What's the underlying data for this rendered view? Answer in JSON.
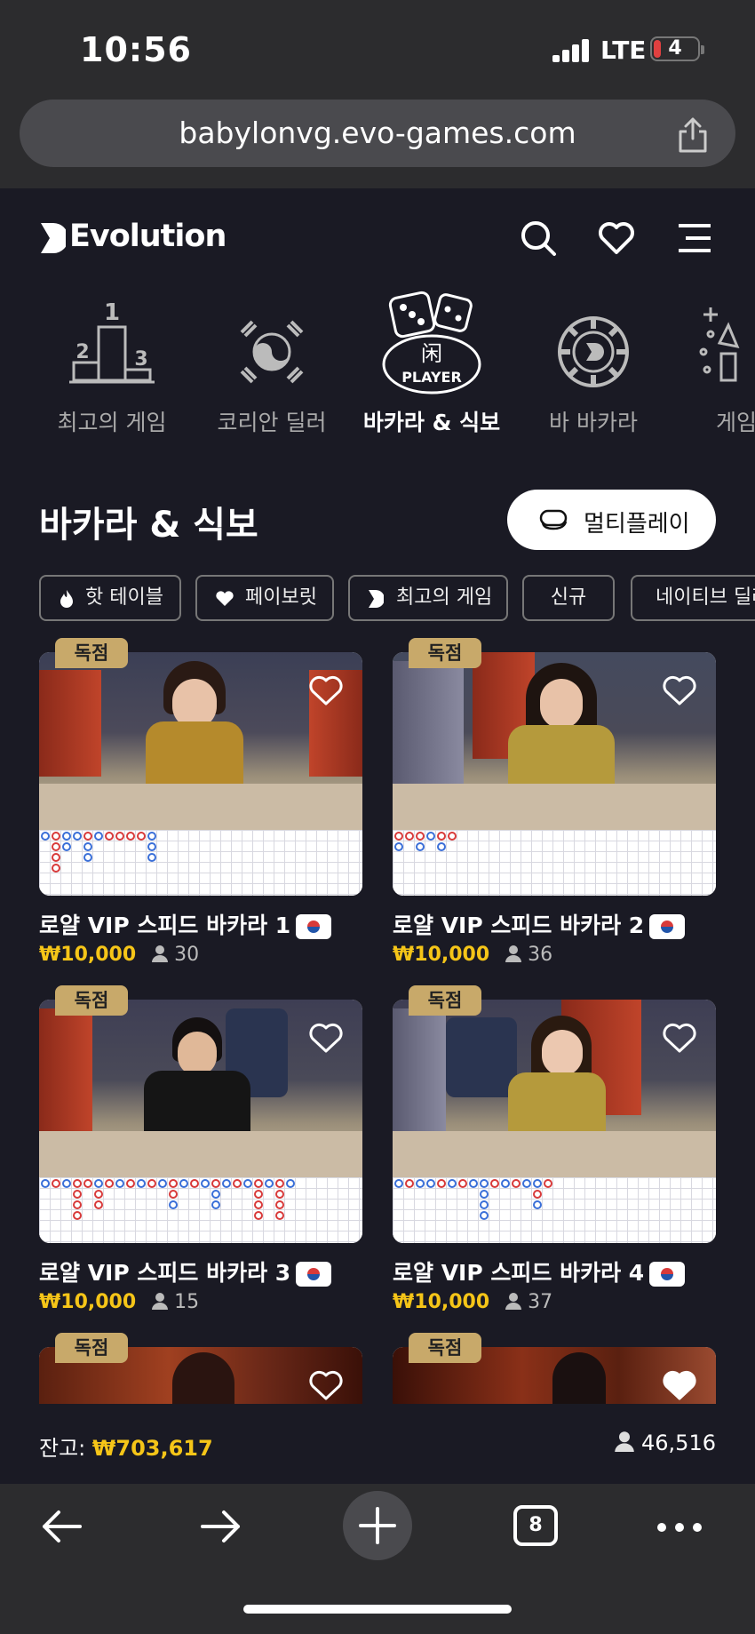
{
  "status": {
    "time": "10:56",
    "network": "LTE",
    "battery": "4"
  },
  "browser": {
    "url": "babylonvg.evo-games.com",
    "tab_count": "8"
  },
  "header": {
    "logo": "Evolution"
  },
  "categories": [
    {
      "label": "최고의 게임",
      "icon": "podium-icon",
      "active": false
    },
    {
      "label": "코리안 딜러",
      "icon": "korea-taeguk-icon",
      "active": false
    },
    {
      "label": "바카라 & 식보",
      "icon": "dice-player-icon",
      "active": true
    },
    {
      "label": "바 바카라",
      "icon": "chip-icon",
      "active": false
    },
    {
      "label": "게임",
      "icon": "show-icon",
      "active": false
    }
  ],
  "section": {
    "title": "바카라 & 식보",
    "multiplay_label": "멀티플레이"
  },
  "filters": [
    {
      "label": "핫 테이블",
      "icon": "fire-icon"
    },
    {
      "label": "페이보릿",
      "icon": "heart-icon"
    },
    {
      "label": "최고의 게임",
      "icon": "evolution-icon"
    },
    {
      "label": "신규",
      "icon": ""
    },
    {
      "label": "네이티브 딜러",
      "icon": ""
    }
  ],
  "tables": [
    {
      "badge": "독점",
      "name": "로얄 VIP 스피드 바카라 1",
      "price": "₩10,000",
      "players": "30"
    },
    {
      "badge": "독점",
      "name": "로얄 VIP 스피드 바카라 2",
      "price": "₩10,000",
      "players": "36"
    },
    {
      "badge": "독점",
      "name": "로얄 VIP 스피드 바카라 3",
      "price": "₩10,000",
      "players": "15"
    },
    {
      "badge": "독점",
      "name": "로얄 VIP 스피드 바카라 4",
      "price": "₩10,000",
      "players": "37"
    },
    {
      "badge": "독점"
    },
    {
      "badge": "독점"
    }
  ],
  "footer": {
    "balance_label": "잔고:",
    "balance": "₩703,617",
    "total_players": "46,516"
  }
}
